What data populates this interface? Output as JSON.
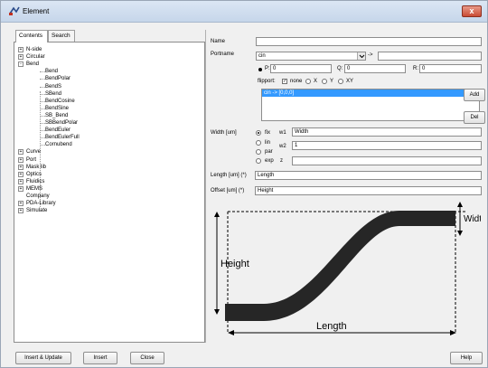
{
  "window": {
    "title": "Element",
    "close_glyph": "x"
  },
  "tabs": [
    "Contents",
    "Search"
  ],
  "tree": [
    {
      "label": "N-side",
      "level": 0,
      "expander": "+"
    },
    {
      "label": "Circular",
      "level": 0,
      "expander": "+"
    },
    {
      "label": "Bend",
      "level": 0,
      "expander": "-"
    },
    {
      "label": "Bend",
      "level": 1
    },
    {
      "label": "BendPolar",
      "level": 1
    },
    {
      "label": "BendS",
      "level": 1
    },
    {
      "label": "SBend",
      "level": 1
    },
    {
      "label": "BendCosine",
      "level": 1
    },
    {
      "label": "BendSine",
      "level": 1
    },
    {
      "label": "SB_Bend",
      "level": 1
    },
    {
      "label": "SBBendPolar",
      "level": 1
    },
    {
      "label": "BendEuler",
      "level": 1
    },
    {
      "label": "BendEulerFull",
      "level": 1
    },
    {
      "label": "Cornubend",
      "level": 1
    },
    {
      "label": "Curve",
      "level": 0,
      "expander": "+"
    },
    {
      "label": "Port",
      "level": 0,
      "expander": "+"
    },
    {
      "label": "Mask lib",
      "level": 0,
      "expander": "+"
    },
    {
      "label": "Optics",
      "level": 0,
      "expander": "+"
    },
    {
      "label": "Fluidics",
      "level": 0,
      "expander": "+"
    },
    {
      "label": "MEMS",
      "level": 0,
      "expander": "+"
    },
    {
      "label": "Company",
      "level": 0
    },
    {
      "label": "PDA-Library",
      "level": 0,
      "expander": "+"
    },
    {
      "label": "Simulate",
      "level": 0,
      "expander": "+"
    }
  ],
  "form": {
    "name_label": "Name",
    "name_value": "",
    "portname_label": "Portname",
    "portname_value": "cin",
    "arrow": "->",
    "portname_target": "",
    "p_label": "P:",
    "p_value": "0",
    "q_label": "Q:",
    "q_value": "0",
    "r_label": "R:",
    "r_value": "0",
    "flipport_label": "flipport:",
    "flip_options": [
      "none",
      "X",
      "Y",
      "XY"
    ],
    "list_item": "cin -> [0,0,0]",
    "add_label": "Add",
    "del_label": "Del",
    "width_label": "Width [um]",
    "width_modes": [
      "fix",
      "lin",
      "par",
      "exp"
    ],
    "w1_label": "w1",
    "w1_value": "Width",
    "w2_label": "w2",
    "w2_value": "1",
    "z_label": "z",
    "z_value": "",
    "length_label": "Length [um] (*)",
    "length_value": "Length",
    "offset_label": "Offset [um] (*)",
    "offset_value": "Height"
  },
  "diagram": {
    "width_label": "Width",
    "height_label": "Height",
    "length_label": "Length"
  },
  "buttons": {
    "insert_update": "Insert & Update",
    "insert": "Insert",
    "close": "Close",
    "help": "Help"
  }
}
